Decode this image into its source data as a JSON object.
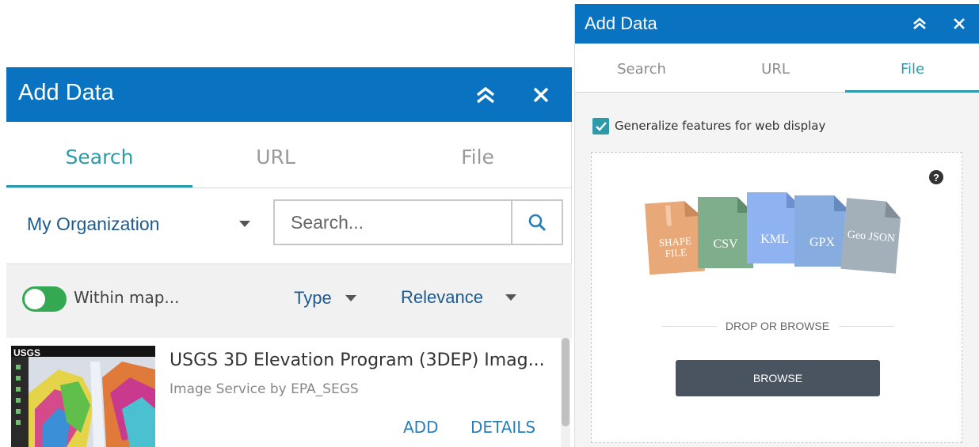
{
  "left_panel": {
    "title": "Add Data",
    "tabs": [
      {
        "label": "Search",
        "active": true
      },
      {
        "label": "URL",
        "active": false
      },
      {
        "label": "File",
        "active": false
      }
    ],
    "scope_select": "My Organization",
    "search": {
      "placeholder": "Search...",
      "value": ""
    },
    "filters": {
      "within_map_label": "Within map...",
      "within_map_on": true,
      "type_label": "Type",
      "sort_label": "Relevance"
    },
    "results": [
      {
        "title": "USGS 3D Elevation Program (3DEP) Imag...",
        "subtitle": "Image Service by EPA_SEGS",
        "thumb_logo": "USGS",
        "add_label": "ADD",
        "details_label": "DETAILS"
      }
    ]
  },
  "right_panel": {
    "title": "Add Data",
    "tabs": [
      {
        "label": "Search",
        "active": false
      },
      {
        "label": "URL",
        "active": false
      },
      {
        "label": "File",
        "active": true
      }
    ],
    "generalize_label": "Generalize features for web display",
    "generalize_checked": true,
    "file_types": [
      {
        "label": "SHAPE FILE",
        "color": "#e8a877"
      },
      {
        "label": "CSV",
        "color": "#7fae8c"
      },
      {
        "label": "KML",
        "color": "#8fb3f0"
      },
      {
        "label": "GPX",
        "color": "#86ace0"
      },
      {
        "label": "Geo JSON",
        "color": "#a3b0ba"
      }
    ],
    "drop_label": "DROP OR BROWSE",
    "browse_label": "BROWSE"
  },
  "colors": {
    "header_blue": "#0a73c1",
    "accent_teal": "#2d9aab",
    "toggle_green": "#35a853",
    "link_blue": "#2a7fb8",
    "browse_dark": "#4a5360"
  },
  "icons": {
    "collapse": "double-chevron-up-icon",
    "close": "close-icon",
    "search": "magnifier-icon",
    "help": "question-circle-icon",
    "check": "checkmark-icon"
  }
}
